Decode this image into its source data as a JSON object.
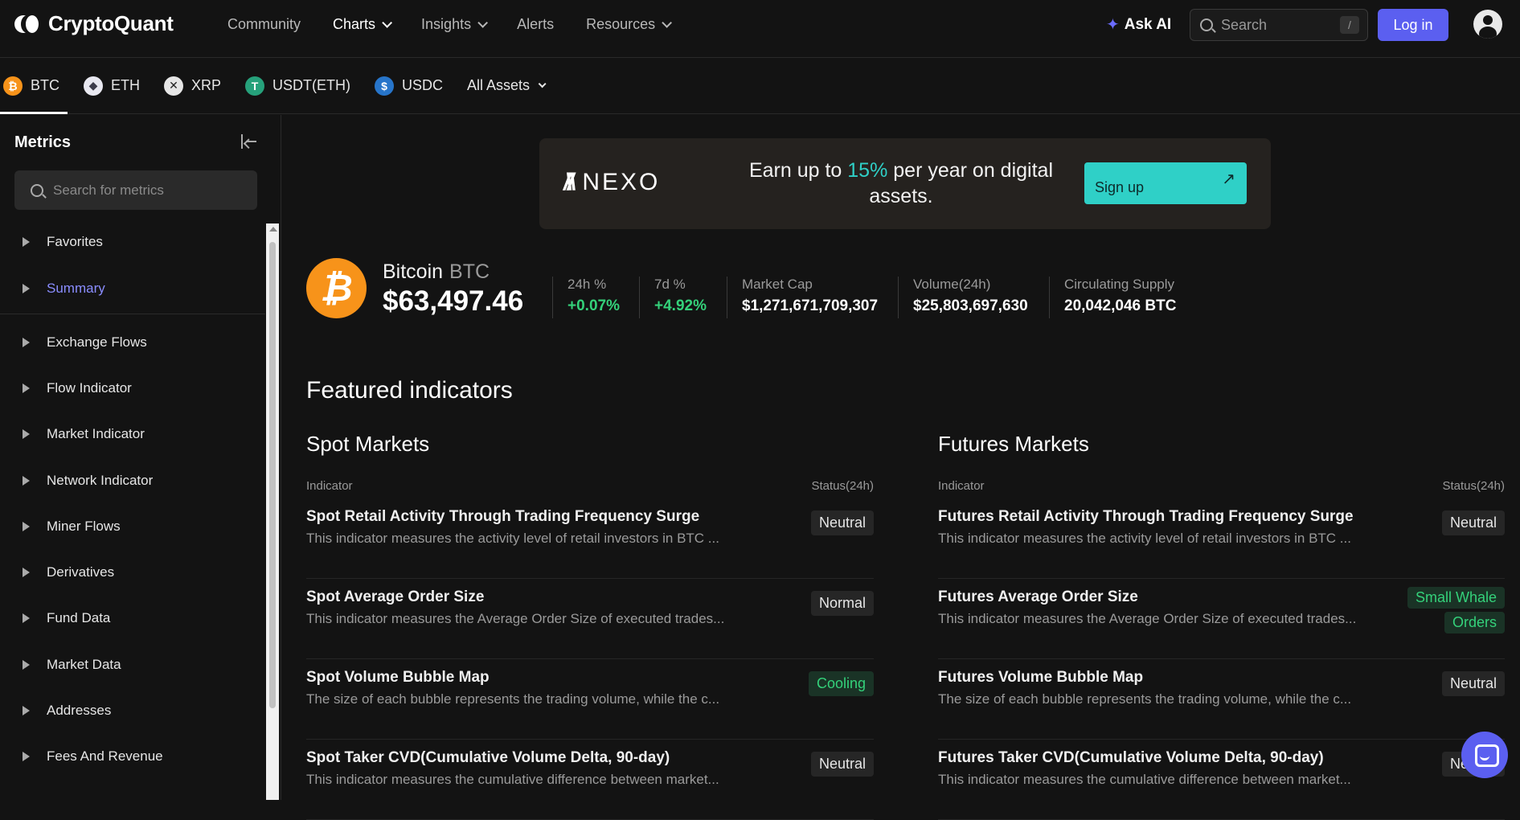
{
  "brand": {
    "name": "CryptoQuant"
  },
  "nav": {
    "links": [
      {
        "label": "Community",
        "dropdown": false
      },
      {
        "label": "Charts",
        "dropdown": true
      },
      {
        "label": "Insights",
        "dropdown": true
      },
      {
        "label": "Alerts",
        "dropdown": false
      },
      {
        "label": "Resources",
        "dropdown": true
      }
    ],
    "ask_ai": "Ask AI",
    "search_placeholder": "Search",
    "search_shortcut": "/",
    "login": "Log in"
  },
  "assets": [
    {
      "label": "BTC",
      "symbol": "₿",
      "color": "#f7931a"
    },
    {
      "label": "ETH",
      "symbol": "◆",
      "color": "#8c8c9a"
    },
    {
      "label": "XRP",
      "symbol": "✕",
      "color": "#5b5b5b"
    },
    {
      "label": "USDT(ETH)",
      "symbol": "T",
      "color": "#26a17b"
    },
    {
      "label": "USDC",
      "symbol": "$",
      "color": "#2775ca"
    },
    {
      "label": "All Assets",
      "symbol": "",
      "color": ""
    }
  ],
  "sidebar": {
    "title": "Metrics",
    "search_placeholder": "Search for metrics",
    "items": [
      {
        "label": "Favorites"
      },
      {
        "label": "Summary"
      },
      {
        "label": "Exchange Flows"
      },
      {
        "label": "Flow Indicator"
      },
      {
        "label": "Market Indicator"
      },
      {
        "label": "Network Indicator"
      },
      {
        "label": "Miner Flows"
      },
      {
        "label": "Derivatives"
      },
      {
        "label": "Fund Data"
      },
      {
        "label": "Market Data"
      },
      {
        "label": "Addresses"
      },
      {
        "label": "Fees And Revenue"
      }
    ],
    "active_item": "Summary"
  },
  "banner": {
    "brand": "NEXO",
    "copy_before": "Earn up to ",
    "copy_highlight": "15%",
    "copy_after": " per year on digital assets.",
    "cta": "Sign up",
    "cta_arrow": "↗",
    "highlight_color": "#2fd0c7"
  },
  "coin": {
    "name": "Bitcoin",
    "ticker": "BTC",
    "price": "$63,497.46",
    "stats": [
      {
        "label": "24h %",
        "value": "+0.07%",
        "positive": true
      },
      {
        "label": "7d %",
        "value": "+4.92%",
        "positive": true
      },
      {
        "label": "Market Cap",
        "value": "$1,271,671,709,307",
        "positive": false
      },
      {
        "label": "Volume(24h)",
        "value": "$25,803,697,630",
        "positive": false
      },
      {
        "label": "Circulating Supply",
        "value": "20,042,046 BTC",
        "positive": false
      }
    ]
  },
  "featured": {
    "title": "Featured indicators",
    "spot": {
      "title": "Spot Markets",
      "col_indicator": "Indicator",
      "col_status": "Status(24h)",
      "rows": [
        {
          "name": "Spot Retail Activity Through Trading Frequency Surge",
          "desc": "This indicator measures the activity level of retail investors in BTC ...",
          "status": [
            "Neutral"
          ],
          "green": false
        },
        {
          "name": "Spot Average Order Size",
          "desc": "This indicator measures the Average Order Size of executed trades...",
          "status": [
            "Normal"
          ],
          "green": false
        },
        {
          "name": "Spot Volume Bubble Map",
          "desc": "The size of each bubble represents the trading volume, while the c...",
          "status": [
            "Cooling"
          ],
          "green": true
        },
        {
          "name": "Spot Taker CVD(Cumulative Volume Delta, 90-day)",
          "desc": "This indicator measures the cumulative difference between market...",
          "status": [
            "Neutral"
          ],
          "green": false
        }
      ]
    },
    "futures": {
      "title": "Futures Markets",
      "col_indicator": "Indicator",
      "col_status": "Status(24h)",
      "rows": [
        {
          "name": "Futures Retail Activity Through Trading Frequency Surge",
          "desc": "This indicator measures the activity level of retail investors in BTC ...",
          "status": [
            "Neutral"
          ],
          "green": false
        },
        {
          "name": "Futures Average Order Size",
          "desc": "This indicator measures the Average Order Size of executed trades...",
          "status": [
            "Small Whale",
            "Orders"
          ],
          "green": true
        },
        {
          "name": "Futures Volume Bubble Map",
          "desc": "The size of each bubble represents the trading volume, while the c...",
          "status": [
            "Neutral"
          ],
          "green": false
        },
        {
          "name": "Futures Taker CVD(Cumulative Volume Delta, 90-day)",
          "desc": "This indicator measures the cumulative difference between market...",
          "status": [
            "Neutral"
          ],
          "green": false
        }
      ]
    }
  }
}
